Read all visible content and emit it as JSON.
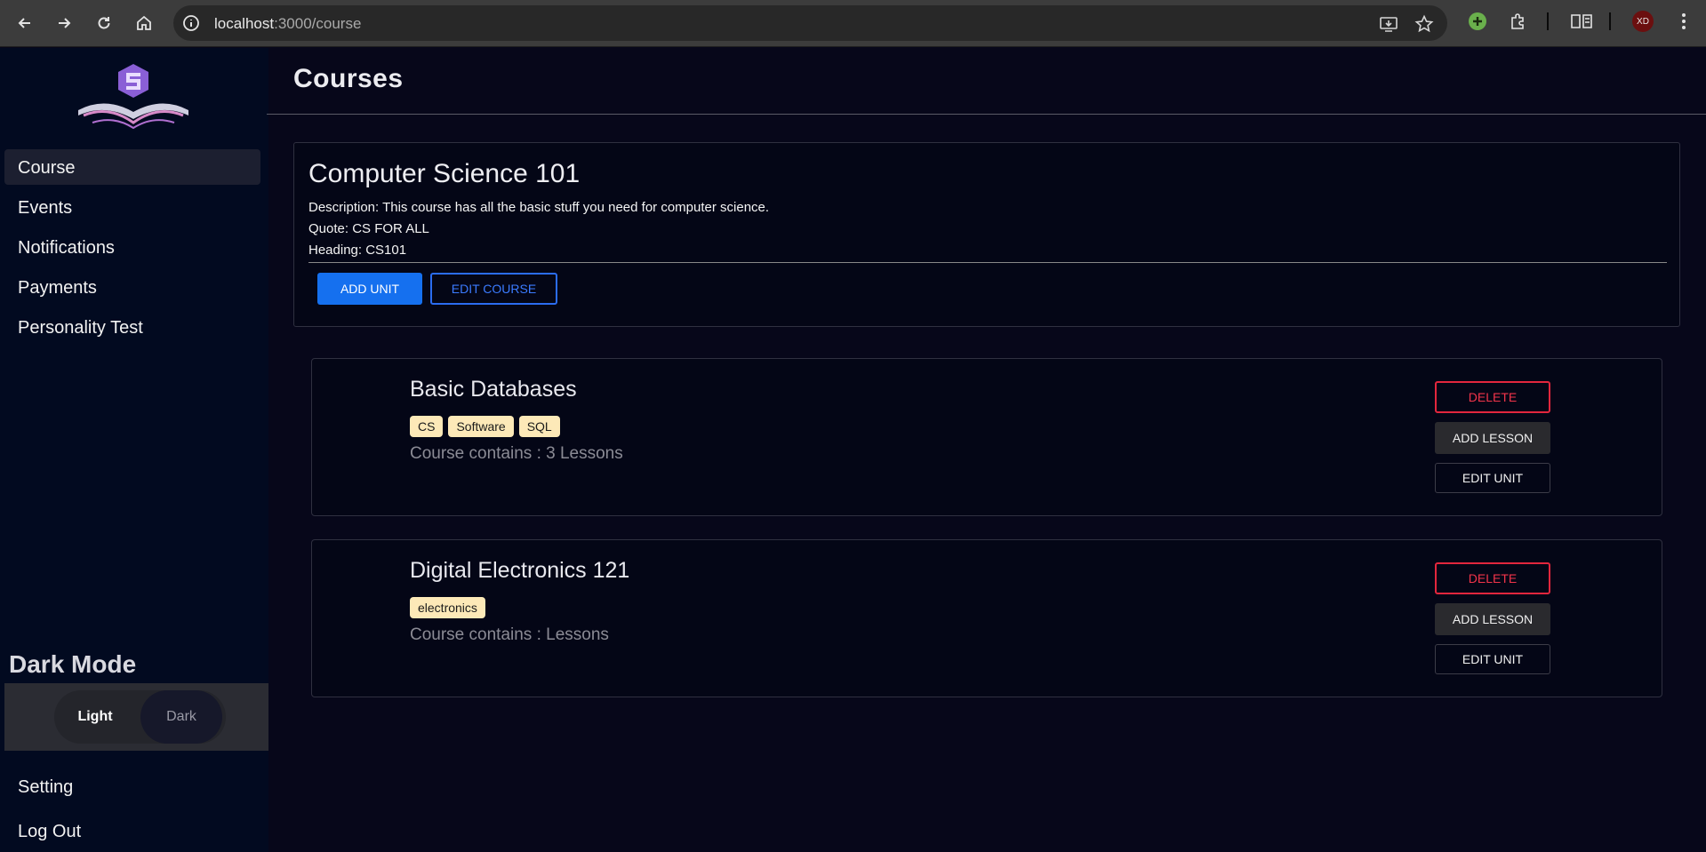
{
  "browser": {
    "url_host": "localhost",
    "url_path": ":3000/course",
    "icons": [
      "back-icon",
      "forward-icon",
      "reload-icon",
      "home-icon",
      "site-info-icon",
      "install-app-icon",
      "bookmark-star-icon",
      "extension-green-icon",
      "extensions-puzzle-icon",
      "reading-list-icon",
      "profile-avatar-icon",
      "menu-kebab-icon"
    ],
    "profile_initials": "XD"
  },
  "sidebar": {
    "items": [
      {
        "label": "Course",
        "active": true
      },
      {
        "label": "Events"
      },
      {
        "label": "Notifications"
      },
      {
        "label": "Payments"
      },
      {
        "label": "Personality Test"
      }
    ],
    "dark_mode": {
      "title": "Dark Mode",
      "options": [
        "Light",
        "Dark"
      ],
      "selected": "Light"
    },
    "bottom_items": [
      {
        "label": "Setting"
      },
      {
        "label": "Log Out"
      }
    ]
  },
  "main": {
    "title": "Courses",
    "course": {
      "name": "Computer Science 101",
      "description": "Description: This course has all the basic stuff you need for computer science.",
      "quote": "Quote: CS FOR ALL",
      "heading": "Heading: CS101",
      "add_unit_label": "ADD UNIT",
      "edit_course_label": "EDIT COURSE"
    },
    "units": [
      {
        "name": "Basic Databases",
        "tags": [
          "CS",
          "Software",
          "SQL"
        ],
        "count": "Course contains : 3 Lessons",
        "delete_label": "DELETE",
        "add_lesson_label": "ADD LESSON",
        "edit_unit_label": "EDIT UNIT"
      },
      {
        "name": "Digital Electronics 121",
        "tags": [
          "electronics"
        ],
        "count": "Course contains : Lessons",
        "delete_label": "DELETE",
        "add_lesson_label": "ADD LESSON",
        "edit_unit_label": "EDIT UNIT"
      }
    ]
  },
  "colors": {
    "background": "#07071a",
    "sidebar": "#020a20",
    "primary": "#1570ef",
    "danger": "#e3263d",
    "tag": "#fde9b8"
  }
}
